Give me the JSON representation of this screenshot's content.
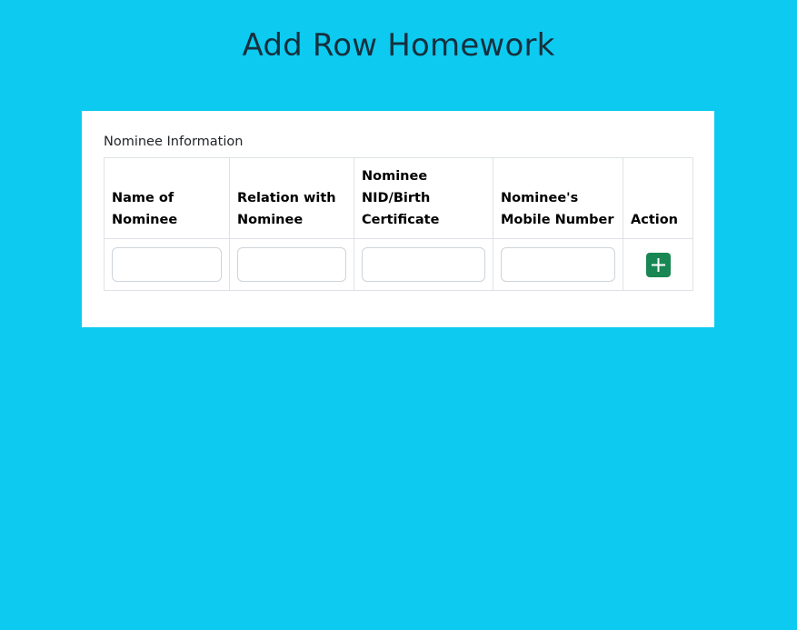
{
  "page": {
    "title": "Add Row Homework"
  },
  "form": {
    "section_label": "Nominee Information",
    "columns": [
      "Name of Nominee",
      "Relation with Nominee",
      "Nominee NID/Birth Certificate",
      "Nominee's Mobile Number",
      "Action"
    ],
    "row": {
      "name_value": "",
      "relation_value": "",
      "nid_value": "",
      "mobile_value": ""
    },
    "add_icon": "plus-icon"
  },
  "colors": {
    "background": "#0dcaf0",
    "card": "#ffffff",
    "add_button": "#198754",
    "title_text": "#16303d"
  }
}
